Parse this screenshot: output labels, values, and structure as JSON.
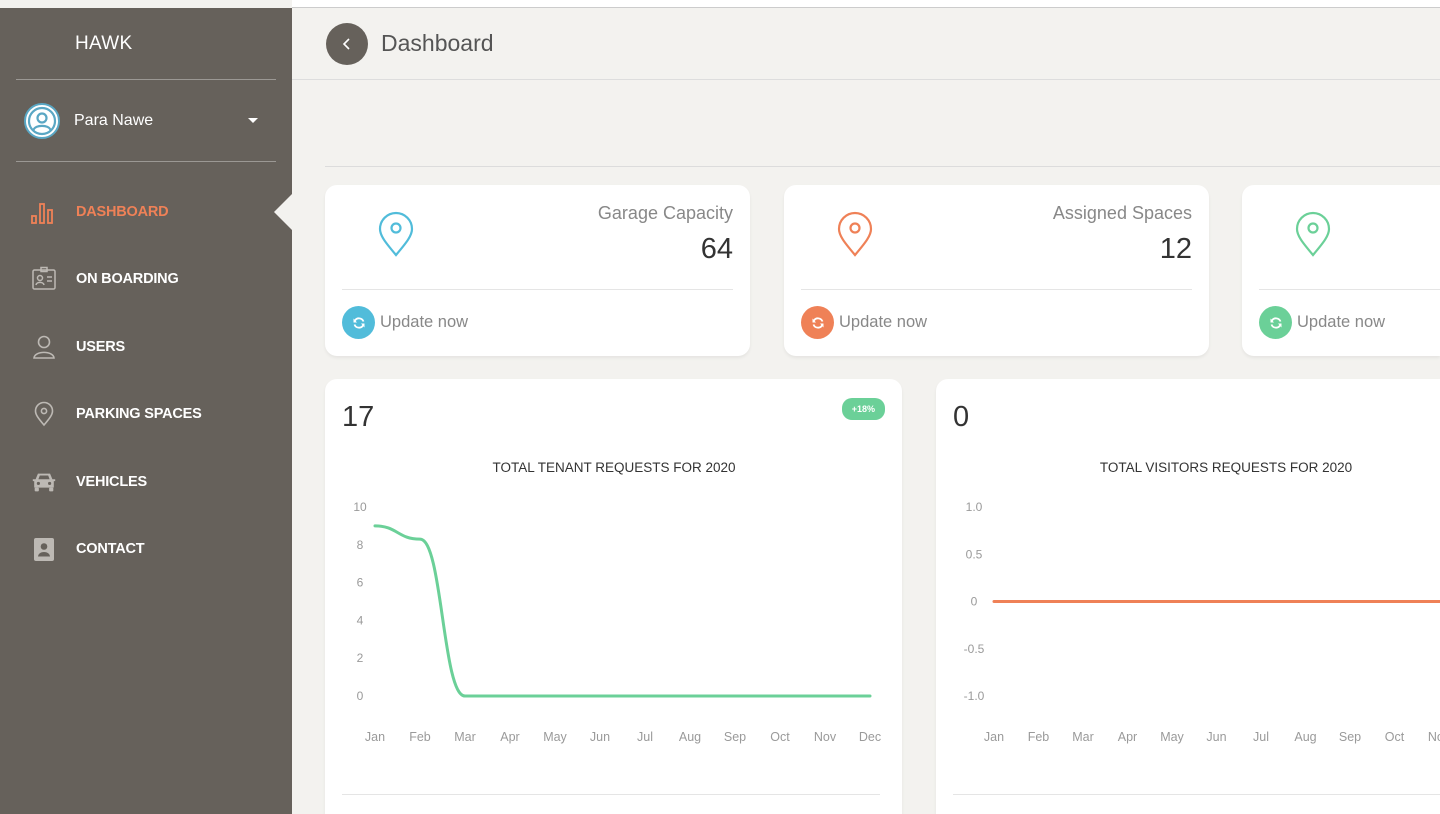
{
  "sidebar": {
    "brand": "HAWK",
    "user_name": "Para Nawe",
    "items": [
      {
        "label": "DASHBOARD",
        "icon": "bar-chart-icon",
        "active": true
      },
      {
        "label": "ON BOARDING",
        "icon": "id-badge-icon",
        "active": false
      },
      {
        "label": "USERS",
        "icon": "user-icon",
        "active": false
      },
      {
        "label": "PARKING SPACES",
        "icon": "map-pin-icon",
        "active": false
      },
      {
        "label": "VEHICLES",
        "icon": "car-icon",
        "active": false
      },
      {
        "label": "CONTACT",
        "icon": "contact-book-icon",
        "active": false
      }
    ]
  },
  "header": {
    "title": "Dashboard"
  },
  "stats": [
    {
      "label": "Garage Capacity",
      "value": "64",
      "footer": "Update now",
      "color": "#51bcda"
    },
    {
      "label": "Assigned Spaces",
      "value": "12",
      "footer": "Update now",
      "color": "#ef8157"
    },
    {
      "label": "",
      "value": "",
      "footer": "Update now",
      "color": "#6bd098"
    }
  ],
  "charts": {
    "tenant_total": "17",
    "tenant_badge": "+18%",
    "visitor_total": "0"
  },
  "chart_data": [
    {
      "type": "line",
      "title": "TOTAL TENANT REQUESTS FOR 2020",
      "categories": [
        "Jan",
        "Feb",
        "Mar",
        "Apr",
        "May",
        "Jun",
        "Jul",
        "Aug",
        "Sep",
        "Oct",
        "Nov",
        "Dec"
      ],
      "series": [
        {
          "values": [
            9,
            8.3,
            0,
            0,
            0,
            0,
            0,
            0,
            0,
            0,
            0,
            0
          ],
          "color": "#6bd098"
        }
      ],
      "yticks": [
        "10",
        "8",
        "6",
        "4",
        "2",
        "0"
      ],
      "ylim": [
        0,
        10
      ],
      "grid": false
    },
    {
      "type": "line",
      "title": "TOTAL VISITORS REQUESTS FOR 2020",
      "categories": [
        "Jan",
        "Feb",
        "Mar",
        "Apr",
        "May",
        "Jun",
        "Jul",
        "Aug",
        "Sep",
        "Oct",
        "Nov"
      ],
      "series": [
        {
          "values": [
            0,
            0,
            0,
            0,
            0,
            0,
            0,
            0,
            0,
            0,
            0
          ],
          "color": "#ef8157"
        }
      ],
      "yticks": [
        "1.0",
        "0.5",
        "0",
        "-0.5",
        "-1.0"
      ],
      "ylim": [
        -1,
        1
      ],
      "grid": false
    }
  ]
}
